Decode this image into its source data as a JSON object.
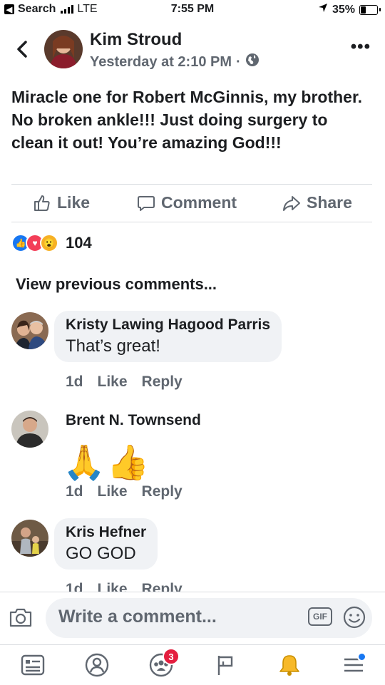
{
  "status_bar": {
    "back_app": "Search",
    "network": "LTE",
    "time": "7:55 PM",
    "battery": "35%",
    "battery_level": 0.35
  },
  "post": {
    "author": "Kim Stroud",
    "timestamp": "Yesterday at 2:10 PM",
    "separator": "·",
    "privacy_icon": "globe-icon",
    "text_parts": [
      "Miracle one for ",
      "Robert McGinnis",
      ", my brother.  No broken ankle!!!  Just doing surgery to clean it out!  You’re amazing God!!!"
    ]
  },
  "actions": {
    "like": "Like",
    "comment": "Comment",
    "share": "Share"
  },
  "reactions": {
    "icons": [
      "like-reaction-icon",
      "love-reaction-icon",
      "wow-reaction-icon"
    ],
    "count": "104"
  },
  "view_previous": "View previous comments...",
  "comments": [
    {
      "author": "Kristy Lawing Hagood Parris",
      "text": "That’s great!",
      "time": "1d",
      "like": "Like",
      "reply": "Reply"
    },
    {
      "author": "Brent N. Townsend",
      "emoji": [
        "🙏",
        "👍"
      ],
      "time": "1d",
      "like": "Like",
      "reply": "Reply"
    },
    {
      "author": "Kris Hefner",
      "text": "GO GOD",
      "time": "1d",
      "like": "Like",
      "reply": "Reply"
    }
  ],
  "composer": {
    "placeholder": "Write a comment...",
    "gif": "GIF"
  },
  "tabs": {
    "groups_badge": "3"
  },
  "colors": {
    "brand_blue": "#1877f2",
    "badge_red": "#e41e3f",
    "secondary_text": "#606770"
  }
}
